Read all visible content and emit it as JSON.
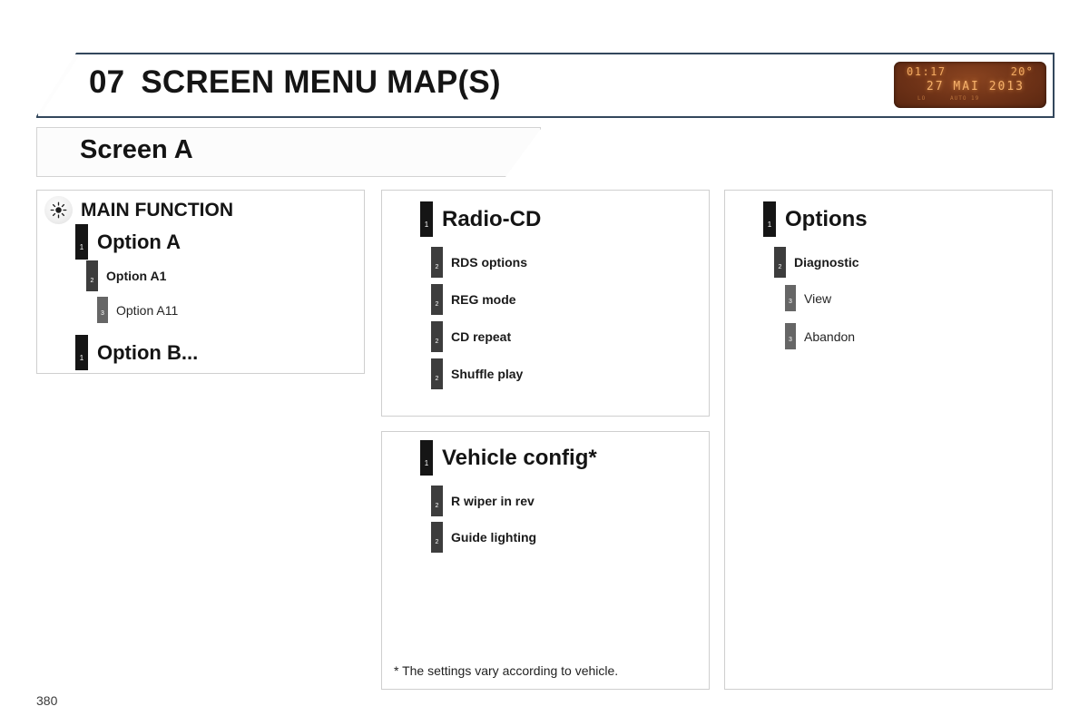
{
  "header": {
    "chapter_number": "07",
    "chapter_title": "SCREEN MENU MAP(S)",
    "border_color": "#33475c"
  },
  "lcd": {
    "clock": "01:17",
    "temperature": "20°",
    "date": "27 MAI 2013",
    "sub_left": "LO",
    "sub_right": "AUTO   19",
    "glow_color": "#f0a860",
    "bezel_color": "#6e3217"
  },
  "screen_tab": {
    "label": "Screen A"
  },
  "panels": {
    "main_function": {
      "icon": "brightness-sun-icon",
      "title": "MAIN FUNCTION",
      "rows": [
        {
          "level": 1,
          "marker": "1",
          "label": "Option A"
        },
        {
          "level": 2,
          "marker": "2",
          "label": "Option A1"
        },
        {
          "level": 3,
          "marker": "3",
          "label": "Option A11"
        },
        {
          "level": 1,
          "marker": "1",
          "label": "Option B..."
        }
      ]
    },
    "radio_cd": {
      "rows": [
        {
          "level": 1,
          "marker": "1",
          "label": "Radio-CD",
          "head": true
        },
        {
          "level": 2,
          "marker": "2",
          "label": "RDS options"
        },
        {
          "level": 2,
          "marker": "2",
          "label": "REG mode"
        },
        {
          "level": 2,
          "marker": "2",
          "label": "CD repeat"
        },
        {
          "level": 2,
          "marker": "2",
          "label": "Shuffle play"
        }
      ]
    },
    "vehicle_config": {
      "rows": [
        {
          "level": 1,
          "marker": "1",
          "label": "Vehicle config*",
          "head": true
        },
        {
          "level": 2,
          "marker": "2",
          "label": "R wiper in rev"
        },
        {
          "level": 2,
          "marker": "2",
          "label": "Guide lighting"
        }
      ],
      "footnote": "* The settings vary according to vehicle."
    },
    "options": {
      "rows": [
        {
          "level": 1,
          "marker": "1",
          "label": "Options",
          "head": true
        },
        {
          "level": 2,
          "marker": "2",
          "label": "Diagnostic"
        },
        {
          "level": 3,
          "marker": "3",
          "label": "View"
        },
        {
          "level": 3,
          "marker": "3",
          "label": "Abandon"
        }
      ]
    }
  },
  "footer": {
    "page_number": "380"
  },
  "level_colors": {
    "lvl1": "#151515",
    "lvl2": "#3d3d3d",
    "lvl3": "#666666"
  }
}
